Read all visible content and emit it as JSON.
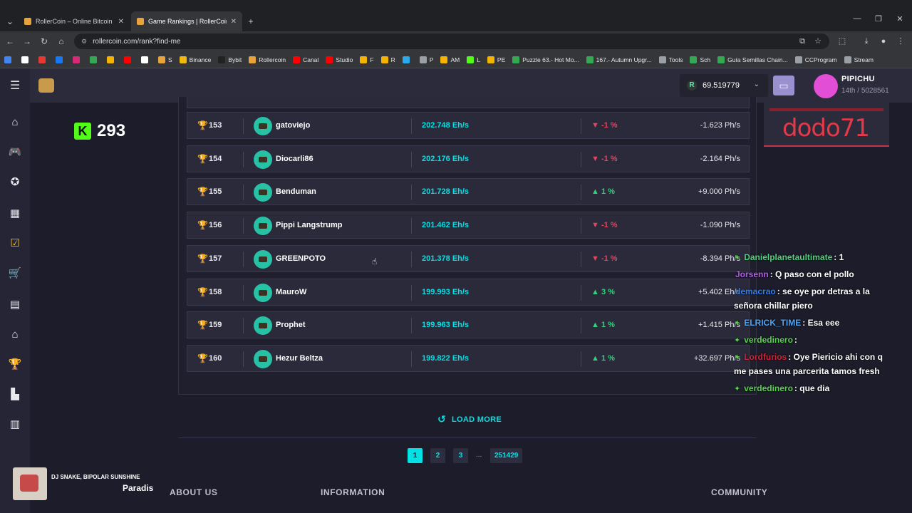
{
  "browser": {
    "tabs": [
      {
        "title": "RollerCoin – Online Bitcoin Mi"
      },
      {
        "title": "Game Rankings | RollerCoin.co"
      }
    ],
    "url": "rollercoin.com/rank?find-me",
    "bookmarks": [
      {
        "label": "",
        "color": "#4285f4"
      },
      {
        "label": "",
        "color": "#ffffff"
      },
      {
        "label": "",
        "color": "#e53935"
      },
      {
        "label": "",
        "color": "#1877f2"
      },
      {
        "label": "",
        "color": "#d62976"
      },
      {
        "label": "",
        "color": "#34a853"
      },
      {
        "label": "",
        "color": "#f4b400"
      },
      {
        "label": "",
        "color": "#ff0000"
      },
      {
        "label": "",
        "color": "#ffffff"
      },
      {
        "label": "S",
        "color": "#e8a33a"
      },
      {
        "label": "Binance",
        "color": "#f0b90b"
      },
      {
        "label": "Bybit",
        "color": "#222222"
      },
      {
        "label": "Rollercoin",
        "color": "#e8a33a"
      },
      {
        "label": "Canal",
        "color": "#ff0000"
      },
      {
        "label": "Studio",
        "color": "#ff0000"
      },
      {
        "label": "F",
        "color": "#f4b400"
      },
      {
        "label": "R",
        "color": "#f4b400"
      },
      {
        "label": "",
        "color": "#2aabee"
      },
      {
        "label": "P",
        "color": "#9aa0a6"
      },
      {
        "label": "AM",
        "color": "#f4b400"
      },
      {
        "label": "L",
        "color": "#53fc18"
      },
      {
        "label": "PE",
        "color": "#f4b400"
      },
      {
        "label": "Puzzle 63.- Hot Mo...",
        "color": "#34a853"
      },
      {
        "label": "167.- Autumn Upgr...",
        "color": "#34a853"
      },
      {
        "label": "Tools",
        "color": "#9aa0a6"
      },
      {
        "label": "Sch",
        "color": "#34a853"
      },
      {
        "label": "Guía Semillas Chain...",
        "color": "#34a853"
      },
      {
        "label": "CCProgram",
        "color": "#9aa0a6"
      },
      {
        "label": "Stream",
        "color": "#9aa0a6"
      }
    ]
  },
  "header": {
    "balance": "69.519779",
    "currency_symbol": "R",
    "username": "PIPICHU",
    "rank_position": "14",
    "rank_suffix": "th",
    "rank_total": "5028561"
  },
  "stream": {
    "kick_count": "293",
    "overlay_name": "dodo71",
    "music_artist": "DJ SNAKE, BIPOLAR SUNSHINE",
    "music_title": "Paradis"
  },
  "ranking": {
    "rows": [
      {
        "rank": "153",
        "name": "gatoviejo",
        "power": "202.748 Eh/s",
        "direction": "down",
        "change": "-1 %",
        "delta": "-1.623 Ph/s"
      },
      {
        "rank": "154",
        "name": "Diocarli86",
        "power": "202.176 Eh/s",
        "direction": "down",
        "change": "-1 %",
        "delta": "-2.164 Ph/s"
      },
      {
        "rank": "155",
        "name": "Benduman",
        "power": "201.728 Eh/s",
        "direction": "up",
        "change": "1 %",
        "delta": "+9.000 Ph/s"
      },
      {
        "rank": "156",
        "name": "Pippi Langstrump",
        "power": "201.462 Eh/s",
        "direction": "down",
        "change": "-1 %",
        "delta": "-1.090 Ph/s"
      },
      {
        "rank": "157",
        "name": "GREENPOTO",
        "power": "201.378 Eh/s",
        "direction": "down",
        "change": "-1 %",
        "delta": "-8.394 Ph/s"
      },
      {
        "rank": "158",
        "name": "MauroW",
        "power": "199.993 Eh/s",
        "direction": "up",
        "change": "3 %",
        "delta": "+5.402 Eh/s"
      },
      {
        "rank": "159",
        "name": "Prophet",
        "power": "199.963 Eh/s",
        "direction": "up",
        "change": "1 %",
        "delta": "+1.415 Ph/s"
      },
      {
        "rank": "160",
        "name": "Hezur Beltza",
        "power": "199.822 Eh/s",
        "direction": "up",
        "change": "1 %",
        "delta": "+32.697 Ph/s"
      }
    ],
    "load_more": "LOAD MORE",
    "pages": [
      "1",
      "2",
      "3"
    ],
    "ellipsis": "...",
    "last_page": "251429"
  },
  "footer": {
    "about": "ABOUT US",
    "information": "INFORMATION",
    "community": "COMMUNITY"
  },
  "chat": [
    {
      "user": "Danielplanetaultimate",
      "text": ": 1",
      "color": "#4fd17a"
    },
    {
      "user": "Jorsenn",
      "text": ": Q paso con el pollo",
      "color": "#b05ce8"
    },
    {
      "user": "demacrao",
      "text": ": se oye por detras a la",
      "color": "#2e7ff0"
    },
    {
      "user": "",
      "text": "señora chillar piero",
      "color": "#ffffff"
    },
    {
      "user": "ELRICK_TIME",
      "text": ": Esa eee",
      "color": "#4fa3f5"
    },
    {
      "user": "verdedinero",
      "text": ":",
      "color": "#58d24c"
    },
    {
      "user": "Lordfurios",
      "text": ": Oye Piericio ahi con q",
      "color": "#d0243a"
    },
    {
      "user": "",
      "text": "me pases una parcerita tamos fresh",
      "color": "#ffffff"
    },
    {
      "user": "verdedinero",
      "text": ": que dia",
      "color": "#58d24c"
    }
  ],
  "colors": {
    "accent": "#03e1e4",
    "up": "#2ed47a",
    "down": "#e0465c",
    "background": "#1c1c2a"
  }
}
